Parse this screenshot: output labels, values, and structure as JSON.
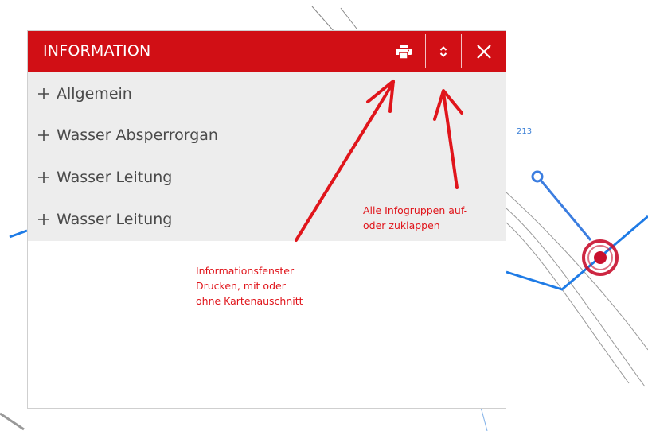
{
  "window": {
    "title": "INFORMATION"
  },
  "header_buttons": [
    {
      "icon": "printer-icon"
    },
    {
      "icon": "expand-collapse-icon"
    },
    {
      "icon": "close-icon"
    }
  ],
  "info_groups": [
    {
      "label": "Allgemein"
    },
    {
      "label": "Wasser Absperrorgan"
    },
    {
      "label": "Wasser Leitung"
    },
    {
      "label": "Wasser Leitung"
    }
  ],
  "annotations": {
    "toggle_note": "Alle Infogruppen auf-\noder zuklappen",
    "print_note": "Informationsfenster\nDrucken, mit oder\nohne Kartenauschnitt"
  },
  "map": {
    "label_213": "213"
  },
  "colors": {
    "header": "#d10f15",
    "group_bg": "#ededed",
    "annotation": "#e0151b",
    "pipe": "#1e7be6",
    "marker": "#c8102e"
  }
}
